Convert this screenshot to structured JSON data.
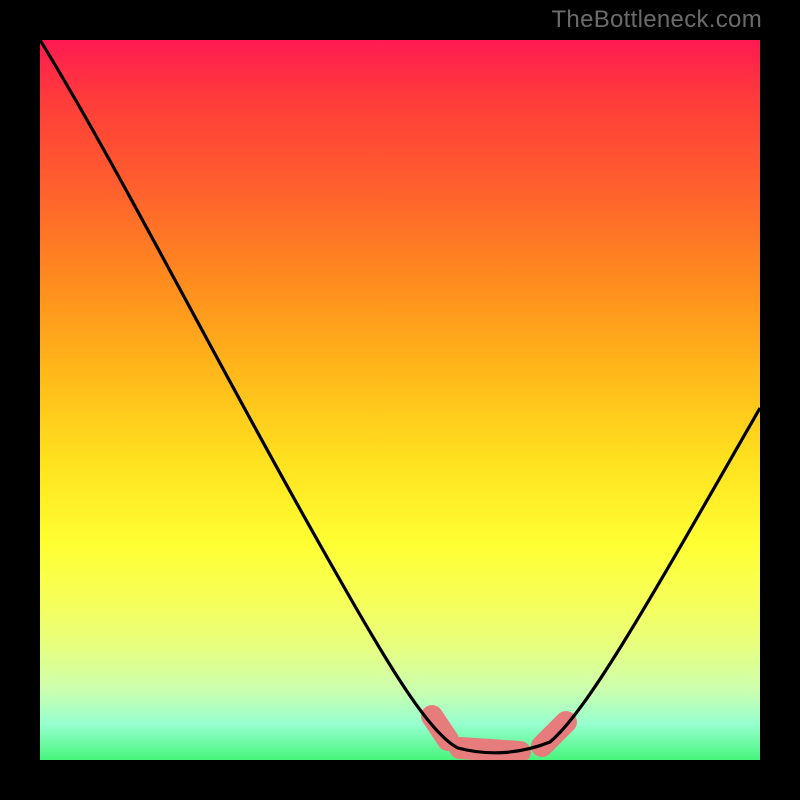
{
  "watermark": "TheBottleneck.com",
  "chart_data": {
    "type": "line",
    "title": "",
    "xlabel": "",
    "ylabel": "",
    "xlim": [
      0,
      100
    ],
    "ylim": [
      0,
      100
    ],
    "series": [
      {
        "name": "bottleneck-curve",
        "x": [
          0,
          10,
          20,
          30,
          40,
          50,
          55,
          58,
          62,
          68,
          72,
          80,
          90,
          100
        ],
        "values": [
          100,
          84,
          68,
          52,
          36,
          20,
          10,
          3,
          1,
          1,
          3,
          14,
          30,
          48
        ]
      }
    ],
    "annotations": [
      {
        "name": "sweet-spot-band",
        "x_range": [
          54,
          74
        ],
        "style": "pink-band"
      }
    ]
  }
}
